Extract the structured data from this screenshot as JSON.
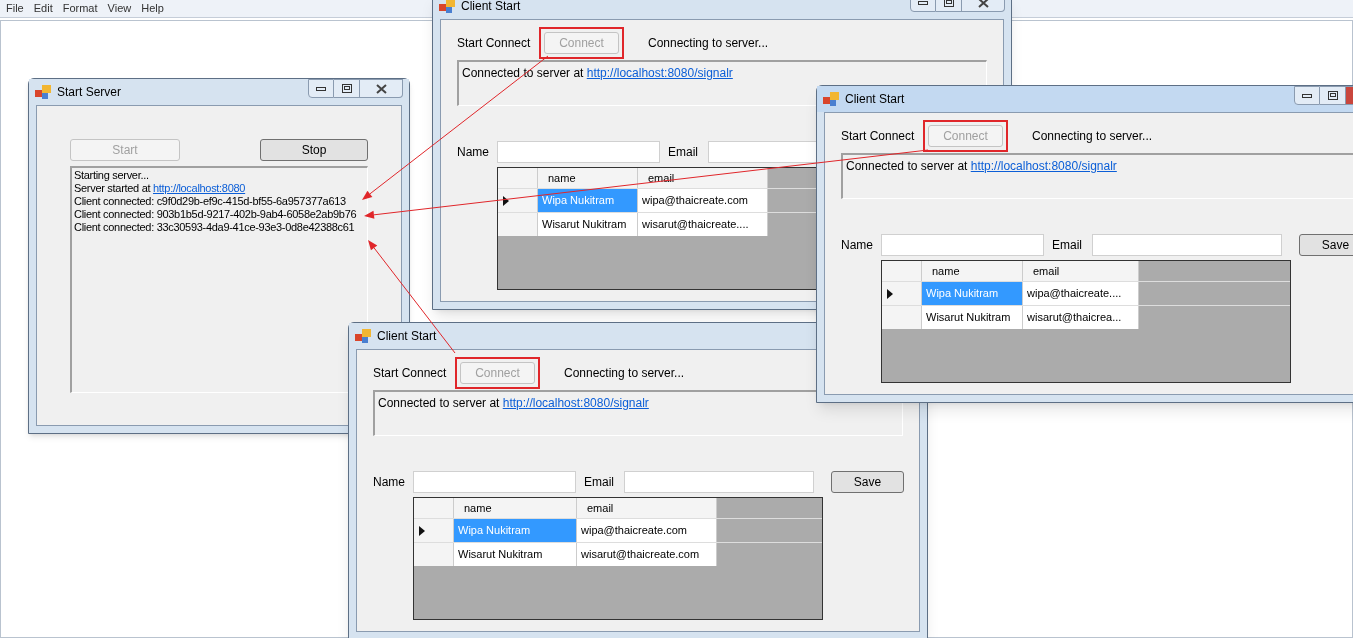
{
  "menu_bar": [
    "File",
    "Edit",
    "Format",
    "View",
    "Help"
  ],
  "server_window": {
    "title": "Start Server",
    "active": false,
    "start_button": {
      "label": "Start",
      "disabled": true
    },
    "stop_button": {
      "label": "Stop",
      "disabled": false
    },
    "log": [
      {
        "text": "Starting server..."
      },
      {
        "text": "Server started at ",
        "link": "http://localhost:8080"
      },
      {
        "text": "Client connected: c9f0d29b-ef9c-415d-bf55-6a957377a613"
      },
      {
        "text": "Client connected: 903b1b5d-9217-402b-9ab4-6058e2ab9b76"
      },
      {
        "text": "Client connected: 33c30593-4da9-41ce-93e3-0d8e42388c61"
      }
    ]
  },
  "client_windows": [
    {
      "title": "Client Start",
      "active": false,
      "window_controls": true,
      "start_label": "Start Connect",
      "connect_button": {
        "label": "Connect",
        "disabled": true,
        "highlighted": true
      },
      "status": "Connecting to server...",
      "log": {
        "text": "Connected to server at ",
        "link": "http://localhost:8080/signalr"
      },
      "name_label": "Name",
      "email_label": "Email",
      "table": {
        "columns": [
          "name",
          "email"
        ],
        "rows": [
          {
            "selected": true,
            "cells": [
              "Wipa Nukitram",
              "wipa@thaicreate.com"
            ]
          },
          {
            "selected": false,
            "cells": [
              "Wisarut Nukitram",
              "wisarut@thaicreate...."
            ]
          }
        ]
      }
    },
    {
      "title": "Client Start",
      "active": true,
      "window_controls": true,
      "start_label": "Start Connect",
      "connect_button": {
        "label": "Connect",
        "disabled": true,
        "highlighted": true
      },
      "status": "Connecting to server...",
      "log": {
        "text": "Connected to server at ",
        "link": "http://localhost:8080/signalr"
      },
      "name_label": "Name",
      "email_label": "Email",
      "save_button": "Save",
      "table": {
        "columns": [
          "name",
          "email"
        ],
        "rows": [
          {
            "selected": true,
            "cells": [
              "Wipa Nukitram",
              "wipa@thaicreate...."
            ]
          },
          {
            "selected": false,
            "cells": [
              "Wisarut Nukitram",
              "wisarut@thaicrea..."
            ]
          }
        ]
      }
    },
    {
      "title": "Client Start",
      "active": false,
      "window_controls": false,
      "start_label": "Start Connect",
      "connect_button": {
        "label": "Connect",
        "disabled": true,
        "highlighted": true
      },
      "status": "Connecting to server...",
      "log": {
        "text": "Connected to server at ",
        "link": "http://localhost:8080/signalr"
      },
      "name_label": "Name",
      "email_label": "Email",
      "save_button": "Save",
      "table": {
        "columns": [
          "name",
          "email"
        ],
        "rows": [
          {
            "selected": true,
            "cells": [
              "Wipa Nukitram",
              "wipa@thaicreate.com"
            ]
          },
          {
            "selected": false,
            "cells": [
              "Wisarut Nukitram",
              "wisarut@thaicreate.com"
            ]
          }
        ]
      }
    }
  ]
}
